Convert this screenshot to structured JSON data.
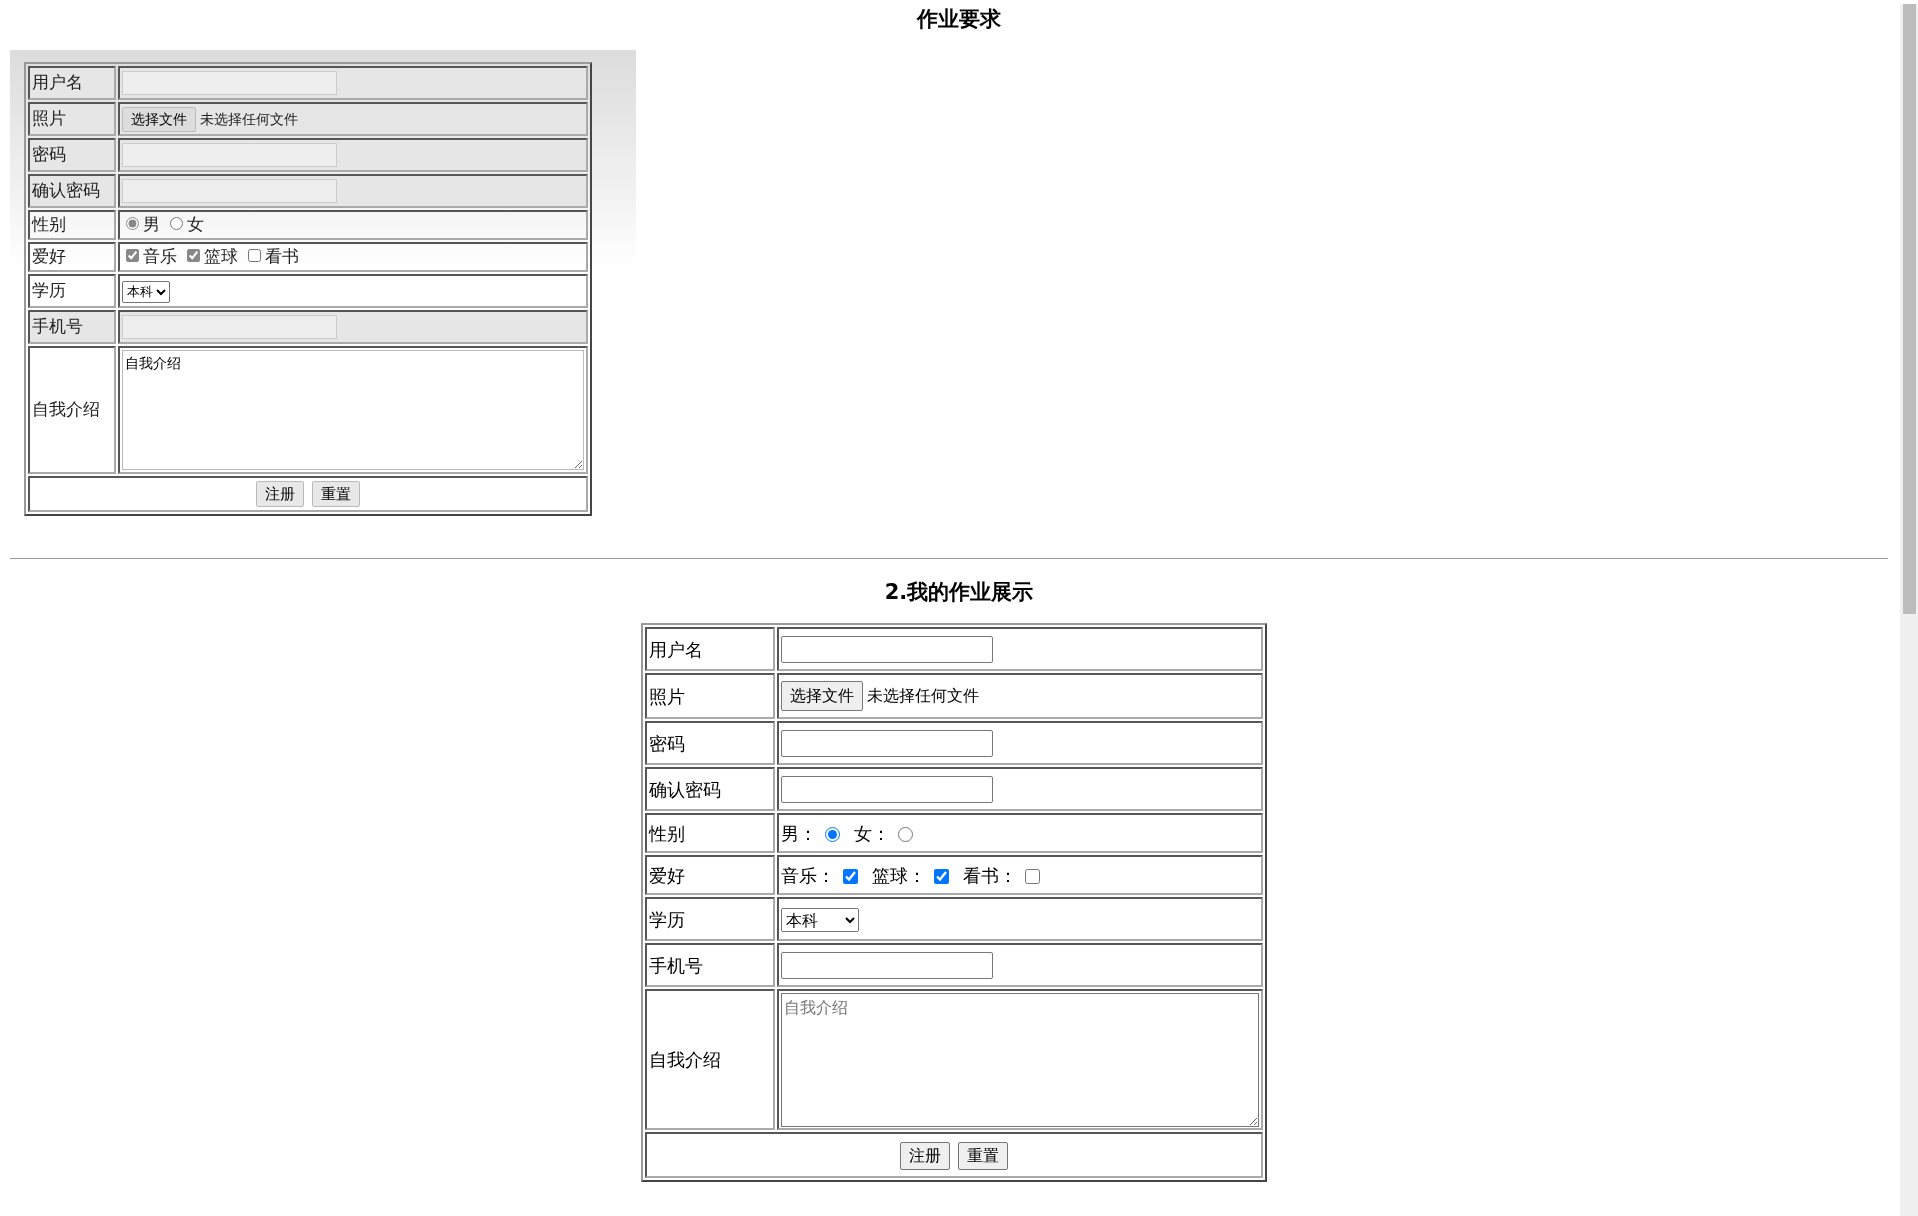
{
  "page_title": "作业要求",
  "reference_form": {
    "rows": [
      {
        "kind": "text",
        "label": "用户名"
      },
      {
        "kind": "file",
        "label": "照片",
        "button_label": "选择文件",
        "file_status": "未选择任何文件"
      },
      {
        "kind": "text",
        "label": "密码"
      },
      {
        "kind": "text",
        "label": "确认密码"
      },
      {
        "kind": "radio",
        "label": "性别",
        "options": [
          {
            "label": "男",
            "selected": true
          },
          {
            "label": "女",
            "selected": false
          }
        ]
      },
      {
        "kind": "checkbox",
        "label": "爱好",
        "options": [
          {
            "label": "音乐",
            "checked": true
          },
          {
            "label": "篮球",
            "checked": true
          },
          {
            "label": "看书",
            "checked": false
          }
        ]
      },
      {
        "kind": "select",
        "label": "学历",
        "value": "本科"
      },
      {
        "kind": "text",
        "label": "手机号"
      },
      {
        "kind": "textarea",
        "label": "自我介绍",
        "value": "自我介绍"
      },
      {
        "kind": "buttons",
        "buttons": [
          "注册",
          "重置"
        ]
      }
    ]
  },
  "section_title": "2.我的作业展示",
  "form": {
    "rows": [
      {
        "kind": "text",
        "label": "用户名"
      },
      {
        "kind": "file",
        "label": "照片",
        "button_label": "选择文件",
        "file_status": "未选择任何文件"
      },
      {
        "kind": "text",
        "label": "密码"
      },
      {
        "kind": "text",
        "label": "确认密码"
      },
      {
        "kind": "radio",
        "label": "性别",
        "options": [
          {
            "label": "男：",
            "selected": true
          },
          {
            "label": "女：",
            "selected": false
          }
        ]
      },
      {
        "kind": "checkbox",
        "label": "爱好",
        "options": [
          {
            "label": "音乐：",
            "checked": true
          },
          {
            "label": "篮球：",
            "checked": true
          },
          {
            "label": "看书：",
            "checked": false
          }
        ]
      },
      {
        "kind": "select",
        "label": "学历",
        "value": "本科"
      },
      {
        "kind": "text",
        "label": "手机号"
      },
      {
        "kind": "textarea",
        "label": "自我介绍",
        "placeholder": "自我介绍"
      },
      {
        "kind": "buttons",
        "buttons": [
          "注册",
          "重置"
        ]
      }
    ]
  }
}
